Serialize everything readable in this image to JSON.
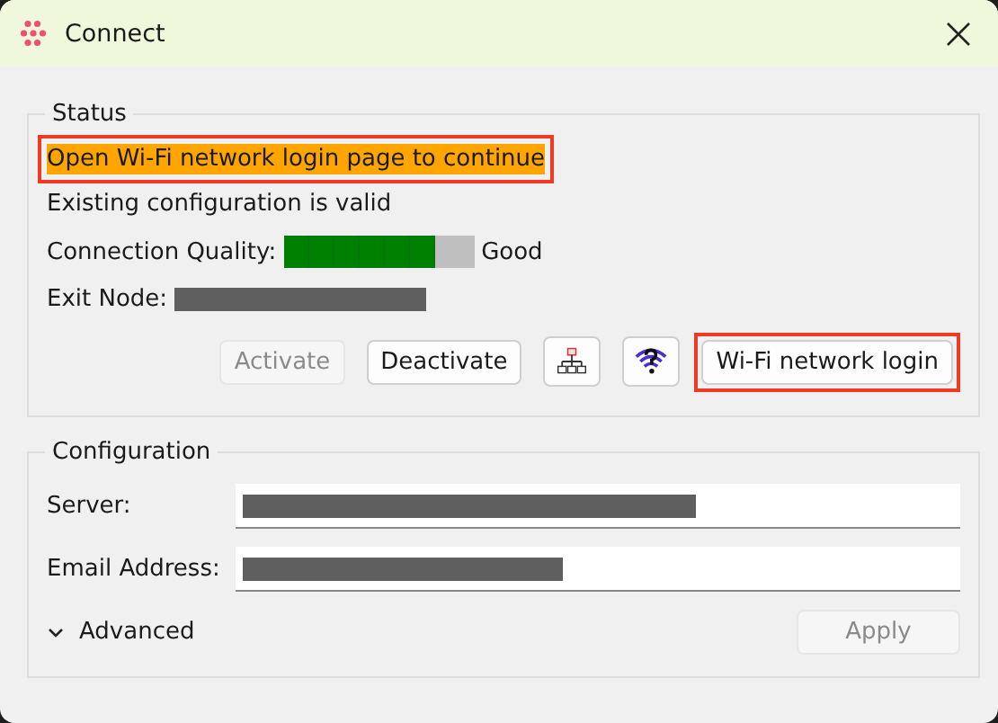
{
  "window": {
    "title": "Connect"
  },
  "status": {
    "title": "Status",
    "banner": {
      "text": "Open Wi-Fi network login page to continue",
      "highlighted": true
    },
    "message": "Existing configuration is valid",
    "quality": {
      "label": "Connection Quality:",
      "level": 0.8,
      "reading": "Good"
    },
    "exit_node": {
      "label": "Exit Node:",
      "redacted": true
    },
    "buttons": [
      {
        "kind": "text",
        "label": "Activate",
        "disabled": true,
        "highlighted": false
      },
      {
        "kind": "text",
        "label": "Deactivate",
        "disabled": false,
        "highlighted": false
      },
      {
        "kind": "network-icon",
        "disabled": false,
        "highlighted": false
      },
      {
        "kind": "wifi-question-icon",
        "disabled": false,
        "highlighted": false
      },
      {
        "kind": "text",
        "label": "Wi-Fi network login",
        "disabled": false,
        "highlighted": true
      }
    ]
  },
  "configuration": {
    "title": "Configuration",
    "fields": [
      {
        "label": "Server:",
        "redacted": true
      },
      {
        "label": "Email Address:",
        "redacted": true
      }
    ],
    "advanced": {
      "label": "Advanced",
      "expanded": false
    },
    "apply": {
      "label": "Apply",
      "disabled": true
    }
  }
}
